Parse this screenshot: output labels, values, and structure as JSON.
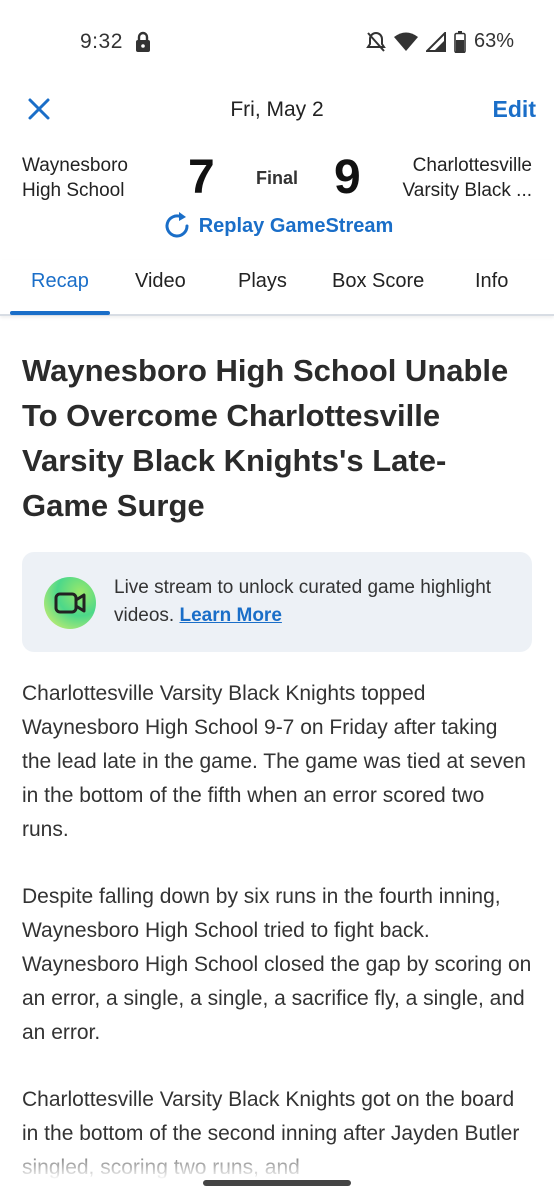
{
  "status_bar": {
    "time": "9:32",
    "battery": "63%",
    "icons": [
      "lock-icon",
      "mute-icon",
      "wifi-icon",
      "signal-icon",
      "battery-icon"
    ]
  },
  "header": {
    "date": "Fri, May 2",
    "edit_label": "Edit",
    "close_icon": "close-icon"
  },
  "game": {
    "home_team_line1": "Waynesboro",
    "home_team_line2": "High School",
    "home_score": "7",
    "status": "Final",
    "away_score": "9",
    "away_team_line1": "Charlottesville",
    "away_team_line2": "Varsity Black ...",
    "replay_label": "Replay GameStream"
  },
  "tabs": [
    {
      "label": "Recap",
      "active": true
    },
    {
      "label": "Video",
      "active": false
    },
    {
      "label": "Plays",
      "active": false
    },
    {
      "label": "Box Score",
      "active": false
    },
    {
      "label": "Info",
      "active": false
    }
  ],
  "article": {
    "title": "Waynesboro High School Unable To Overcome Charlottesville Varsity Black Knights's Late-Game Surge",
    "promo_text": "Live stream to unlock curated game highlight videos.",
    "promo_link": "Learn More",
    "paragraphs": [
      "Charlottesville Varsity Black Knights topped Waynesboro High School 9-7 on Friday after taking the lead late in the game. The game was tied at seven in the bottom of the fifth when an error scored two runs.",
      "Despite falling down by six runs in the fourth inning, Waynesboro High School tried to fight back. Waynesboro High School closed the gap by scoring on an error, a single, a single, a sacrifice fly, a single, and an error.",
      "Charlottesville Varsity Black Knights got on the board in the bottom of the second inning after Jayden Butler singled, scoring two runs, and"
    ]
  },
  "colors": {
    "accent": "#1a6ec8",
    "promo_bg": "#edf1f6",
    "text": "#333333"
  }
}
